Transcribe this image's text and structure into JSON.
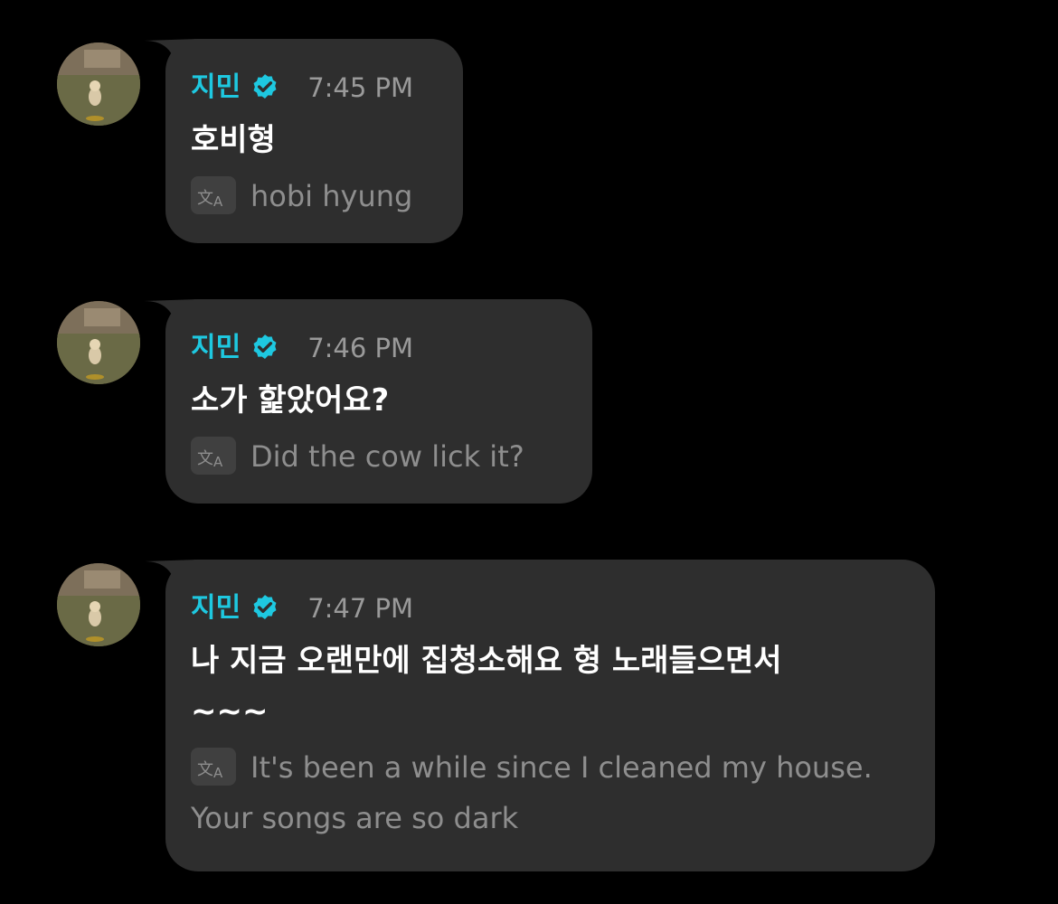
{
  "messages": [
    {
      "sender": "지민",
      "time": "7:45 PM",
      "text": "호비형",
      "translation": "hobi hyung"
    },
    {
      "sender": "지민",
      "time": "7:46 PM",
      "text": "소가 핥았어요?",
      "translation": "Did the cow lick it?"
    },
    {
      "sender": "지민",
      "time": "7:47 PM",
      "text": "나 지금 오랜만에 집청소해요 형 노래들으면서\n~~~",
      "translation": "It's been a while since I cleaned my house. Your songs are so dark"
    }
  ],
  "colors": {
    "background": "#000000",
    "bubble": "#2e2e2e",
    "sender": "#1ec8e0",
    "time": "#9a9a9a",
    "translation": "#8e8e8e"
  },
  "icons": {
    "verified": "verified-badge-icon",
    "translate": "translate-icon"
  }
}
